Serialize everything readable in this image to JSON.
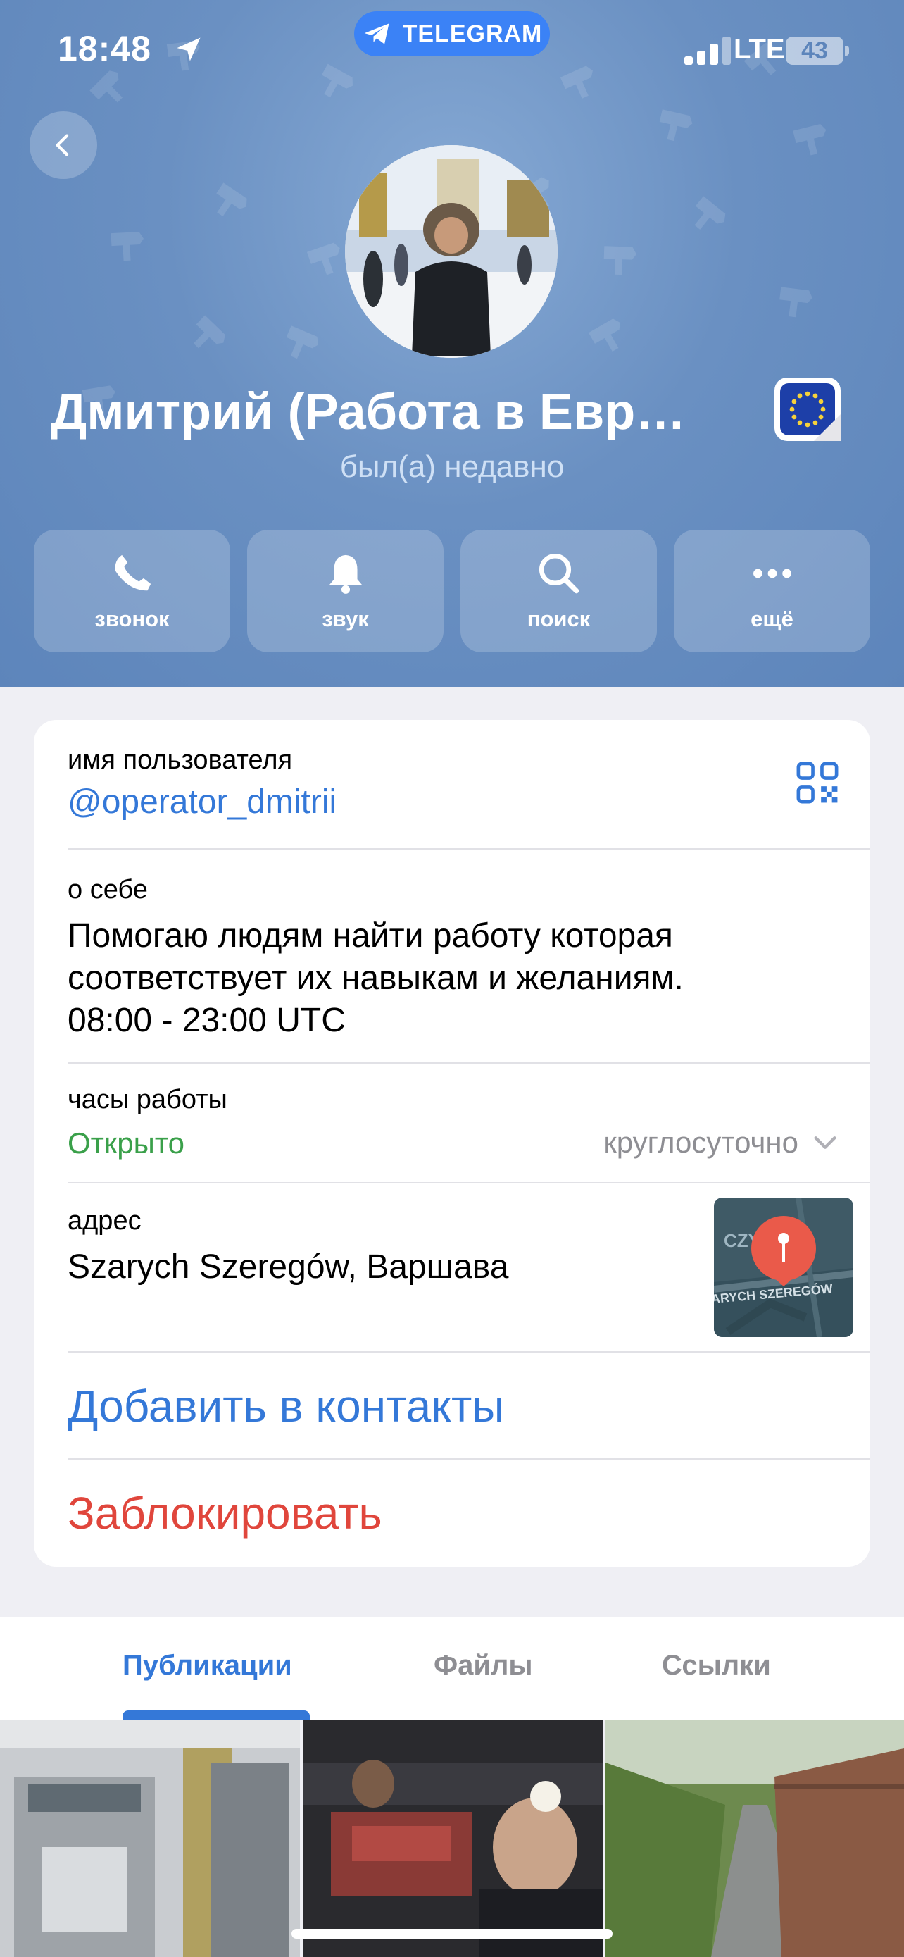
{
  "status_bar": {
    "time": "18:48",
    "app_pill": "TELEGRAM",
    "network": "LTE",
    "battery": "43"
  },
  "profile": {
    "name": "Дмитрий (Работа в Евр…",
    "status": "был(а) недавно"
  },
  "actions": [
    {
      "label": "звонок",
      "icon": "phone-icon"
    },
    {
      "label": "звук",
      "icon": "bell-icon"
    },
    {
      "label": "поиск",
      "icon": "search-icon"
    },
    {
      "label": "ещё",
      "icon": "more-icon"
    }
  ],
  "info": {
    "username_label": "имя пользователя",
    "username": "@operator_dmitrii",
    "bio_label": "о себе",
    "bio_lines": [
      "Помогаю людям найти работу которая",
      "соответствует их навыкам и желаниям.",
      "08:00 - 23:00 UTC"
    ],
    "hours_label": "часы работы",
    "hours_status": "Открыто",
    "hours_value": "круглосуточно",
    "address_label": "адрес",
    "address": "Szarych Szeregów, Варшава",
    "map_text_1": "CZY",
    "map_text_2": "ARYCH SZEREGÓW",
    "add_contact": "Добавить в контакты",
    "block": "Заблокировать"
  },
  "tabs": [
    {
      "label": "Публикации",
      "active": true
    },
    {
      "label": "Файлы",
      "active": false
    },
    {
      "label": "Ссылки",
      "active": false
    }
  ],
  "colors": {
    "header_bg": "#6a90c2",
    "accent_blue": "#3478d8",
    "open_green": "#3aa04a",
    "danger_red": "#e0463c"
  }
}
